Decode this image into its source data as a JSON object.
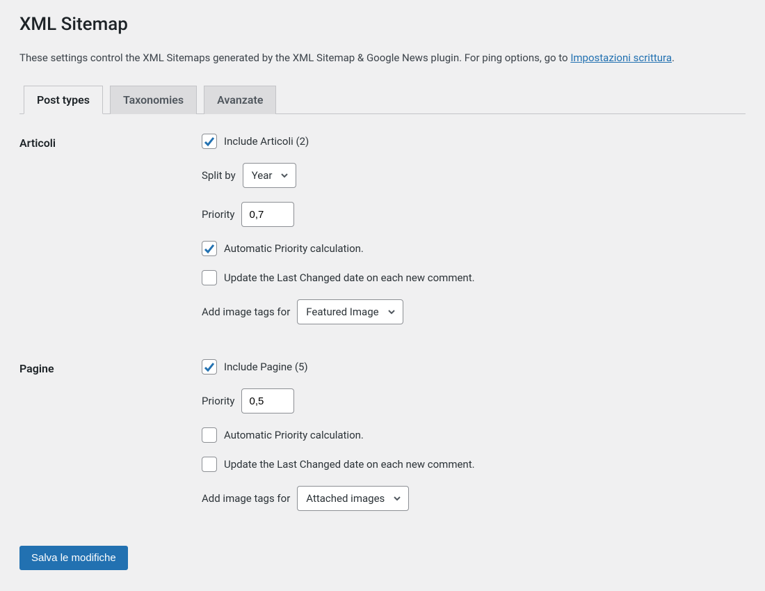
{
  "page": {
    "title": "XML Sitemap",
    "intro_prefix": "These settings control the XML Sitemaps generated by the XML Sitemap & Google News plugin. For ping options, go to ",
    "intro_link": "Impostazioni scrittura",
    "intro_suffix": "."
  },
  "tabs": {
    "post_types": "Post types",
    "taxonomies": "Taxonomies",
    "advanced": "Avanzate"
  },
  "sections": {
    "articoli": {
      "heading": "Articoli",
      "include_label": "Include Articoli (2)",
      "include_checked": true,
      "split_by_label": "Split by",
      "split_by_value": "Year",
      "priority_label": "Priority",
      "priority_value": "0,7",
      "auto_priority_label": "Automatic Priority calculation.",
      "auto_priority_checked": true,
      "update_last_label": "Update the Last Changed date on each new comment.",
      "update_last_checked": false,
      "image_tags_label": "Add image tags for",
      "image_tags_value": "Featured Image"
    },
    "pagine": {
      "heading": "Pagine",
      "include_label": "Include Pagine (5)",
      "include_checked": true,
      "priority_label": "Priority",
      "priority_value": "0,5",
      "auto_priority_label": "Automatic Priority calculation.",
      "auto_priority_checked": false,
      "update_last_label": "Update the Last Changed date on each new comment.",
      "update_last_checked": false,
      "image_tags_label": "Add image tags for",
      "image_tags_value": "Attached images"
    }
  },
  "submit": {
    "label": "Salva le modifiche"
  }
}
